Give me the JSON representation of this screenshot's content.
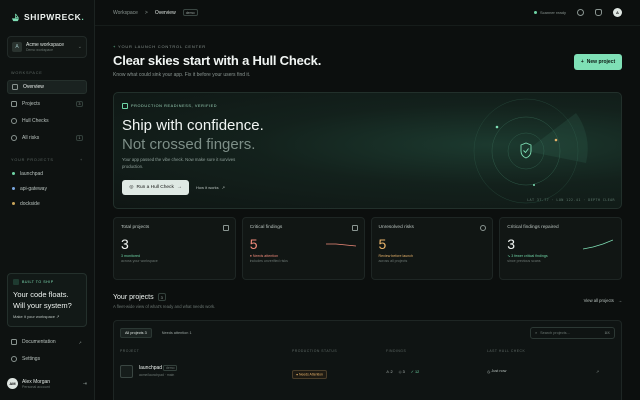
{
  "brand": {
    "name": "SHIPWRECK",
    "dot": "."
  },
  "workspace": {
    "name": "Acme workspace",
    "sub": "Demo workspace",
    "initial": "A"
  },
  "sidebar": {
    "workspace_label": "WORKSPACE",
    "items": [
      {
        "label": "Overview",
        "badge": ""
      },
      {
        "label": "Projects",
        "badge": "3"
      },
      {
        "label": "Hull Checks",
        "badge": ""
      },
      {
        "label": "All risks",
        "badge": "1"
      }
    ],
    "projects_label": "YOUR PROJECTS",
    "projects_add": "+",
    "projects": [
      "launchpad",
      "api-gateway",
      "dockside"
    ],
    "promo": {
      "tag": "BUILT TO SHIP",
      "line1": "Your code floats.",
      "line2": "Will your system?",
      "link": "Make it your workspace"
    },
    "bottom": [
      {
        "label": "Documentation"
      },
      {
        "label": "Settings"
      }
    ],
    "user": {
      "name": "Alex Morgan",
      "sub": "Personal account",
      "initials": "AM"
    }
  },
  "topbar": {
    "crumb_root": "Workspace",
    "crumb_sep": ">",
    "crumb_current": "Overview",
    "crumb_badge": "demo",
    "status": "Scanner ready",
    "avatar": "A"
  },
  "header": {
    "eyebrow": "YOUR LAUNCH CONTROL CENTER",
    "title": "Clear skies start with a Hull Check.",
    "subtitle": "Know what could sink your app. Fix it before your users find it.",
    "new_button": "New project",
    "new_icon": "+"
  },
  "hero": {
    "tag": "PRODUCTION READINESS, VERIFIED",
    "line1": "Ship with confidence.",
    "line2": "Not crossed fingers.",
    "body": "Your app passed the vibe check. Now make sure it survives production.",
    "button": "Run a Hull Check",
    "link": "How it works",
    "coords": "LAT 37.77 · LON 122.41 · DEPTH CLEAR"
  },
  "stats": [
    {
      "label": "Total projects",
      "value": "3",
      "note": "3 monitored",
      "sub": "across your workspace"
    },
    {
      "label": "Critical findings",
      "value": "5",
      "note": "Needs attention",
      "sub": "includes unverified risks"
    },
    {
      "label": "Unresolved risks",
      "value": "5",
      "note": "Review before launch",
      "sub": "across all projects"
    },
    {
      "label": "Critical findings repaired",
      "value": "3",
      "note": "3 fewer critical findings",
      "sub": "since previous scans"
    }
  ],
  "projects_section": {
    "title": "Your projects",
    "count": "3",
    "subtitle": "A fleet-wide view of what's ready and what needs work.",
    "view_all": "View all projects"
  },
  "table": {
    "filters": [
      {
        "label": "All projects",
        "count": "3"
      },
      {
        "label": "Needs attention",
        "count": "1"
      }
    ],
    "search_placeholder": "Search projects...",
    "search_kbd": "⌘K",
    "columns": [
      "PROJECT",
      "PRODUCTION STATUS",
      "FINDINGS",
      "LAST HULL CHECK"
    ],
    "rows": [
      {
        "name": "launchpad",
        "tag": "demo",
        "meta1": "acme/launchpad",
        "meta2": "main",
        "status": "Needs Attention",
        "f_red": "2",
        "f_amber": "3",
        "f_green": "12",
        "last": "Just now"
      }
    ]
  },
  "colors": {
    "accent": "#7fe0b6",
    "critical": "#f08a7a",
    "warning": "#e8b36a",
    "bg": "#0c0f0e"
  }
}
